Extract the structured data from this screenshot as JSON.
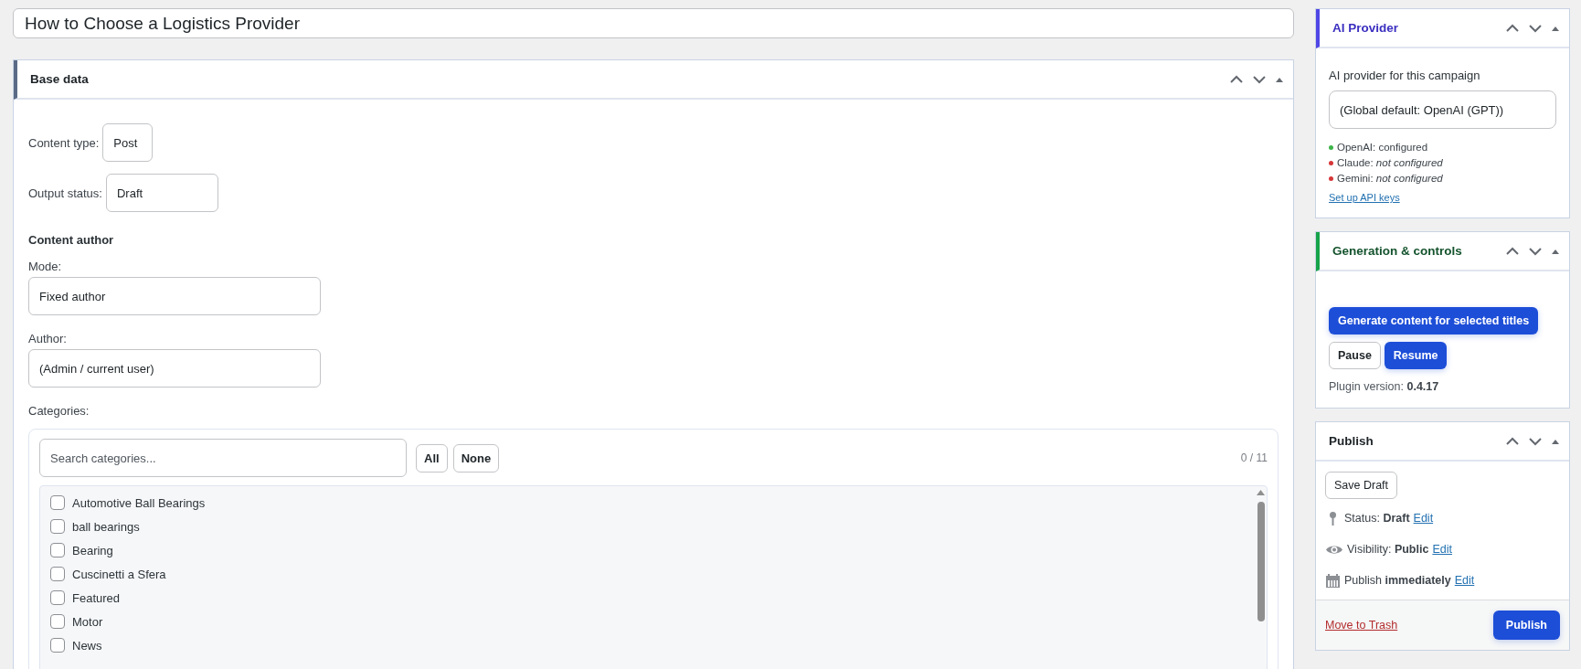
{
  "post_title": {
    "value": "How to Choose a Logistics Provider"
  },
  "base_data": {
    "title": "Base data",
    "content_type": {
      "label": "Content type:",
      "value": "Post"
    },
    "output_status": {
      "label": "Output status:",
      "value": "Draft"
    },
    "content_author": {
      "heading": "Content author",
      "mode": {
        "label": "Mode:",
        "value": "Fixed author"
      },
      "author": {
        "label": "Author:",
        "value": "(Admin / current user)"
      }
    },
    "categories": {
      "label": "Categories:",
      "search": {
        "placeholder": "Search categories..."
      },
      "buttons": [
        "All",
        "None"
      ],
      "count": "0 / 11",
      "items": [
        {
          "label": "Automotive Ball Bearings",
          "checked": false
        },
        {
          "label": "ball bearings",
          "checked": false
        },
        {
          "label": "Bearing",
          "checked": false
        },
        {
          "label": "Cuscinetti a Sfera",
          "checked": false
        },
        {
          "label": "Featured",
          "checked": false
        },
        {
          "label": "Motor",
          "checked": false
        },
        {
          "label": "News",
          "checked": false
        }
      ]
    }
  },
  "ai_provider": {
    "title": "AI Provider",
    "label": "AI provider for this campaign",
    "select": {
      "value": "(Global default: OpenAI (GPT))"
    },
    "providers": [
      {
        "text": "OpenAI: configured",
        "color": "#3cb44a"
      },
      {
        "text": "Claude: *not configured*",
        "color": "#d63638"
      },
      {
        "text": "Gemini: *not configured*",
        "color": "#d63638"
      }
    ],
    "link": "Set up API keys"
  },
  "generation": {
    "title": "Generation & controls",
    "generate_button": "Generate content for selected titles",
    "buttons": [
      {
        "label": "Pause",
        "kind": "secondary"
      },
      {
        "label": "Resume",
        "kind": "primary"
      }
    ],
    "version": "Plugin version: **0.4.17**"
  },
  "publish": {
    "title": "Publish",
    "save_button": "Save Draft",
    "rows": [
      {
        "kind": "status",
        "text": "Status: **Draft**",
        "link": "Edit"
      },
      {
        "kind": "visibility",
        "text": "Visibility: **Public**",
        "link": "Edit"
      },
      {
        "kind": "schedule",
        "text": "Publish **immediately**",
        "link": "Edit"
      }
    ],
    "trash_link": "Move to Trash",
    "publish_button": "Publish"
  }
}
